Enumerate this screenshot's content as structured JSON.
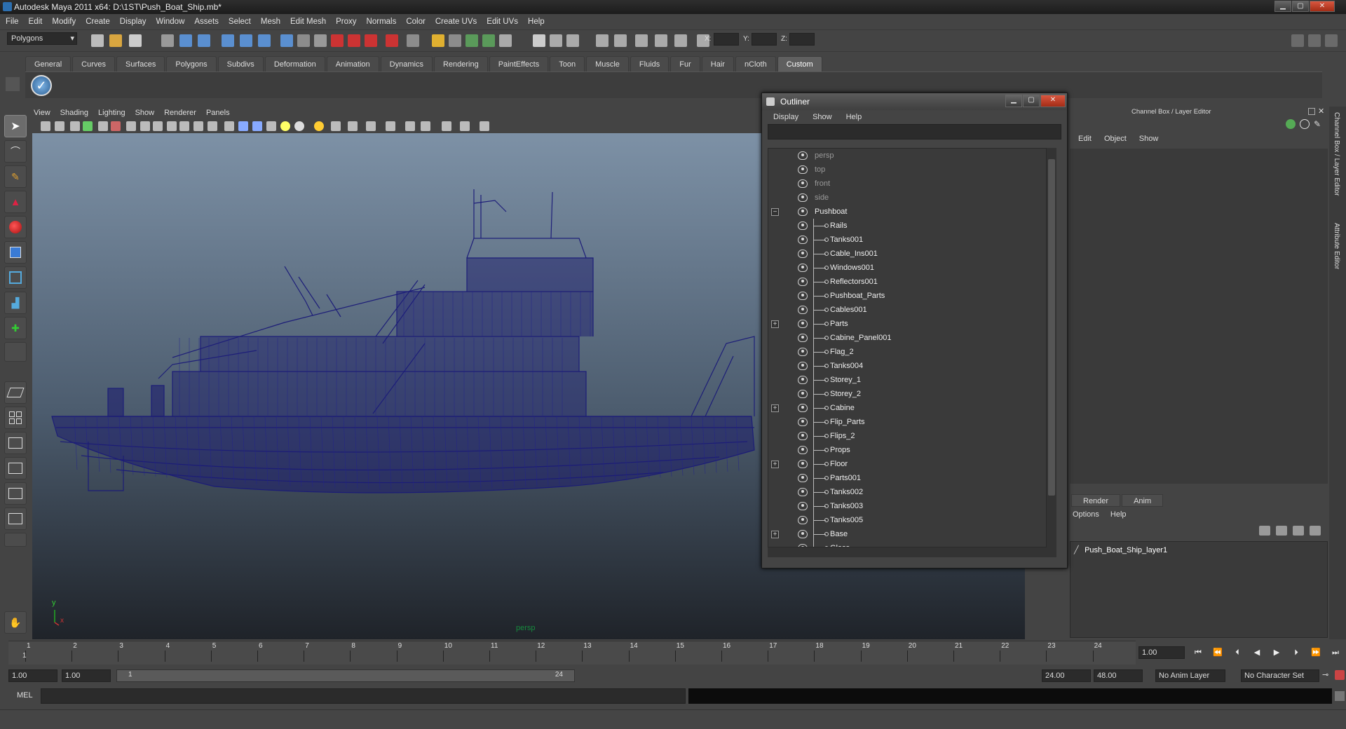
{
  "title": "Autodesk Maya 2011 x64: D:\\1ST\\Push_Boat_Ship.mb*",
  "menubar": [
    "File",
    "Edit",
    "Modify",
    "Create",
    "Display",
    "Window",
    "Assets",
    "Select",
    "Mesh",
    "Edit Mesh",
    "Proxy",
    "Normals",
    "Color",
    "Create UVs",
    "Edit UVs",
    "Help"
  ],
  "statusline": {
    "menuset": "Polygons",
    "x_label": "X:",
    "y_label": "Y:",
    "z_label": "Z:"
  },
  "shelf_tabs": [
    "General",
    "Curves",
    "Surfaces",
    "Polygons",
    "Subdivs",
    "Deformation",
    "Animation",
    "Dynamics",
    "Rendering",
    "PaintEffects",
    "Toon",
    "Muscle",
    "Fluids",
    "Fur",
    "Hair",
    "nCloth",
    "Custom"
  ],
  "shelf_active": "Custom",
  "viewport": {
    "menus": [
      "View",
      "Shading",
      "Lighting",
      "Show",
      "Renderer",
      "Panels"
    ],
    "camera_label": "persp",
    "axis_y": "y",
    "axis_x": "x"
  },
  "outliner": {
    "title": "Outliner",
    "menus": [
      "Display",
      "Show",
      "Help"
    ],
    "items": [
      {
        "label": "persp",
        "type": "camera",
        "expandable": false
      },
      {
        "label": "top",
        "type": "camera",
        "expandable": false
      },
      {
        "label": "front",
        "type": "camera",
        "expandable": false
      },
      {
        "label": "side",
        "type": "camera",
        "expandable": false
      },
      {
        "label": "Pushboat",
        "type": "root",
        "expandable": true,
        "expanded": true
      },
      {
        "label": "Rails",
        "type": "child",
        "expandable": false
      },
      {
        "label": "Tanks001",
        "type": "child",
        "expandable": false
      },
      {
        "label": "Cable_Ins001",
        "type": "child",
        "expandable": false
      },
      {
        "label": "Windows001",
        "type": "child",
        "expandable": false
      },
      {
        "label": "Reflectors001",
        "type": "child",
        "expandable": false
      },
      {
        "label": "Pushboat_Parts",
        "type": "child",
        "expandable": false
      },
      {
        "label": "Cables001",
        "type": "child",
        "expandable": false
      },
      {
        "label": "Parts",
        "type": "child",
        "expandable": true
      },
      {
        "label": "Cabine_Panel001",
        "type": "child",
        "expandable": false
      },
      {
        "label": "Flag_2",
        "type": "child",
        "expandable": false
      },
      {
        "label": "Tanks004",
        "type": "child",
        "expandable": false
      },
      {
        "label": "Storey_1",
        "type": "child",
        "expandable": false
      },
      {
        "label": "Storey_2",
        "type": "child",
        "expandable": false
      },
      {
        "label": "Cabine",
        "type": "child",
        "expandable": true
      },
      {
        "label": "Flip_Parts",
        "type": "child",
        "expandable": false
      },
      {
        "label": "Flips_2",
        "type": "child",
        "expandable": false
      },
      {
        "label": "Props",
        "type": "child",
        "expandable": false
      },
      {
        "label": "Floor",
        "type": "child",
        "expandable": true
      },
      {
        "label": "Parts001",
        "type": "child",
        "expandable": false
      },
      {
        "label": "Tanks002",
        "type": "child",
        "expandable": false
      },
      {
        "label": "Tanks003",
        "type": "child",
        "expandable": false
      },
      {
        "label": "Tanks005",
        "type": "child",
        "expandable": false
      },
      {
        "label": "Base",
        "type": "child",
        "expandable": true
      },
      {
        "label": "Glass",
        "type": "child",
        "expandable": false
      }
    ]
  },
  "channel_box": {
    "title": "Channel Box / Layer Editor",
    "menus": [
      "Edit",
      "Object",
      "Show"
    ],
    "layer_tabs": [
      "Render",
      "Anim"
    ],
    "layer_menus": [
      "Options",
      "Help"
    ],
    "layer_name": "Push_Boat_Ship_layer1"
  },
  "side_tabs": [
    "Channel Box / Layer Editor",
    "Attribute Editor"
  ],
  "timeline": {
    "ticks": [
      "1",
      "2",
      "3",
      "4",
      "5",
      "6",
      "7",
      "8",
      "9",
      "10",
      "11",
      "12",
      "13",
      "14",
      "15",
      "16",
      "17",
      "18",
      "19",
      "20",
      "21",
      "22",
      "23",
      "24"
    ],
    "current_frame_marker": "1",
    "current_time": "1.00"
  },
  "range": {
    "start_time": "1.00",
    "playback_start": "1.00",
    "slider_start": "1",
    "slider_end": "24",
    "playback_end": "24.00",
    "end_time": "48.00",
    "anim_layer": "No Anim Layer",
    "character_set": "No Character Set"
  },
  "cmdline": {
    "label": "MEL"
  },
  "colors": {
    "wireframe": "#1a1a78",
    "viewport_top": "#7d91a6",
    "viewport_bottom": "#1f2329",
    "camera_label": "#178a3e"
  }
}
